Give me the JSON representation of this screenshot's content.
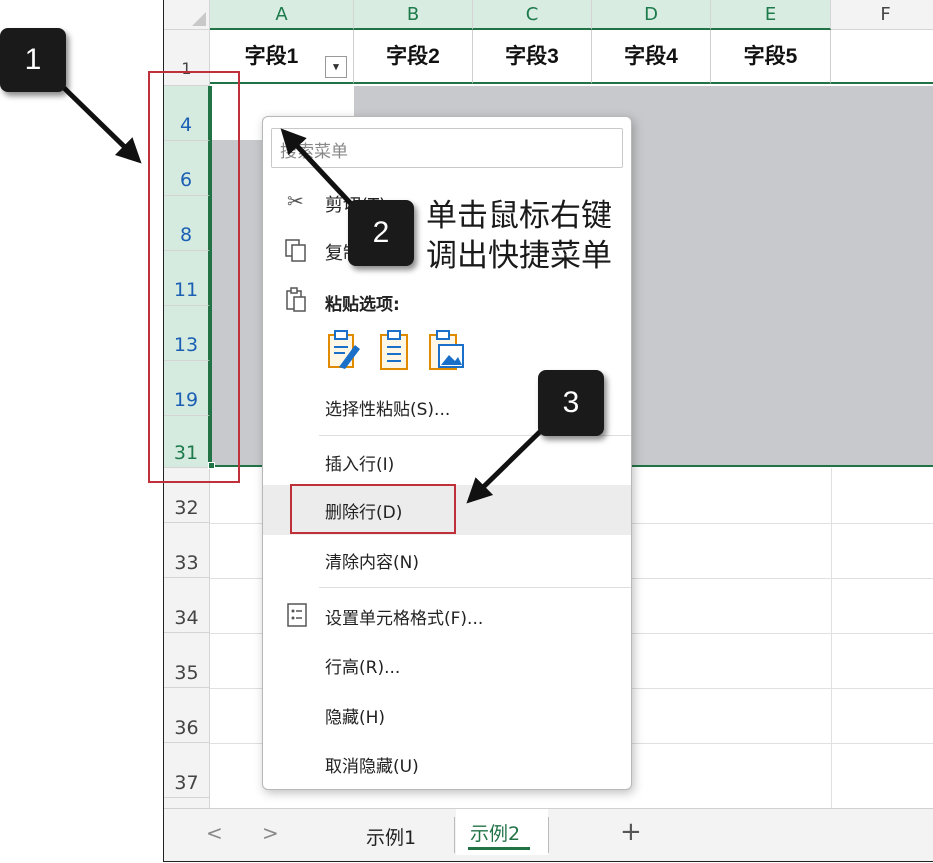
{
  "columns": [
    "A",
    "B",
    "C",
    "D",
    "E",
    "F"
  ],
  "header_row_number": "1",
  "fields": [
    "字段1",
    "字段2",
    "字段3",
    "字段4",
    "字段5"
  ],
  "filter_glyph": "▾",
  "selected_rows": [
    "4",
    "6",
    "8",
    "11",
    "13",
    "19",
    "31"
  ],
  "other_rows": [
    "32",
    "33",
    "34",
    "35",
    "36",
    "37"
  ],
  "menu": {
    "search_placeholder": "搜索菜单",
    "cut": "剪切(T)",
    "copy": "复制(C)",
    "paste_options": "粘贴选项:",
    "paste_special": "选择性粘贴(S)...",
    "insert_row": "插入行(I)",
    "delete_row": "删除行(D)",
    "clear_contents": "清除内容(N)",
    "format_cells": "设置单元格格式(F)...",
    "row_height": "行高(R)...",
    "hide": "隐藏(H)",
    "unhide": "取消隐藏(U)"
  },
  "tabs": {
    "prev": "<",
    "next": ">",
    "sheet1": "示例1",
    "sheet2": "示例2",
    "add": "+"
  },
  "annotations": {
    "badge1": "1",
    "badge2": "2",
    "badge3": "3",
    "note_line1": "单击鼠标右键",
    "note_line2": "调出快捷菜单"
  },
  "colors": {
    "accent_green": "#217346",
    "highlight_red": "#c0303a",
    "selection_gray": "#c8c9cc"
  }
}
